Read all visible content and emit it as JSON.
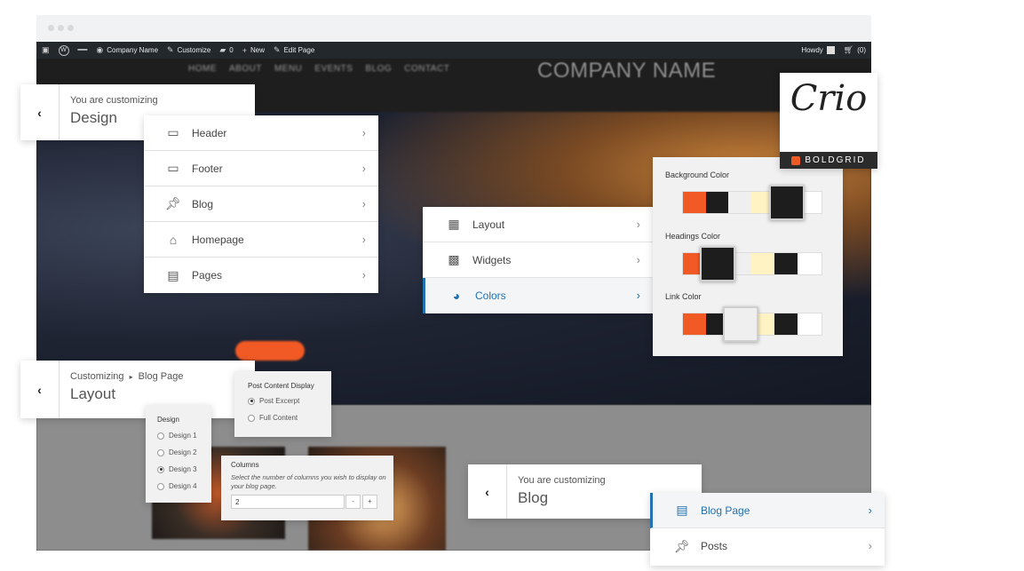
{
  "adminbar": {
    "company": "Company Name",
    "customize": "Customize",
    "comments_count": "0",
    "new": "New",
    "edit_page": "Edit Page",
    "howdy": "Howdy",
    "cart_count": "(0)"
  },
  "site": {
    "nav": [
      "HOME",
      "ABOUT",
      "MENU",
      "EVENTS",
      "BLOG",
      "CONTACT"
    ],
    "brand": "COMPANY NAME"
  },
  "design_panel": {
    "small": "You are customizing",
    "big": "Design",
    "items": [
      {
        "label": "Header",
        "icon": "header-icon"
      },
      {
        "label": "Footer",
        "icon": "footer-icon"
      },
      {
        "label": "Blog",
        "icon": "pin-icon"
      },
      {
        "label": "Homepage",
        "icon": "home-icon"
      },
      {
        "label": "Pages",
        "icon": "pages-icon"
      }
    ]
  },
  "layout_menu": {
    "items": [
      {
        "label": "Layout",
        "icon": "layout-icon"
      },
      {
        "label": "Widgets",
        "icon": "widgets-icon"
      },
      {
        "label": "Colors",
        "icon": "palette-icon",
        "active": true
      }
    ]
  },
  "colors_panel": {
    "background_label": "Background Color",
    "headings_label": "Headings Color",
    "link_label": "Link Color",
    "palette": [
      "#f15a24",
      "#1d1d1d",
      "#efefef",
      "#fff3c4",
      "#1d1d1d",
      "#ffffff"
    ]
  },
  "logo": {
    "script": "Crio",
    "brand": "BOLDGRID"
  },
  "layout_panel": {
    "crumb": "Customizing",
    "crumb_page": "Blog Page",
    "big": "Layout"
  },
  "post_content": {
    "title": "Post Content Display",
    "options": [
      "Post Excerpt",
      "Full Content"
    ],
    "selected": "Post Excerpt"
  },
  "design_options": {
    "title": "Design",
    "options": [
      "Design 1",
      "Design 2",
      "Design 3",
      "Design 4"
    ],
    "selected": "Design 3"
  },
  "columns": {
    "title": "Columns",
    "description": "Select the number of columns you wish to display on your blog page.",
    "value": "2",
    "minus": "-",
    "plus": "+"
  },
  "blog_panel": {
    "small": "You are customizing",
    "big": "Blog",
    "items": [
      {
        "label": "Blog Page",
        "icon": "document-icon",
        "active": true
      },
      {
        "label": "Posts",
        "icon": "pin-icon"
      }
    ]
  }
}
